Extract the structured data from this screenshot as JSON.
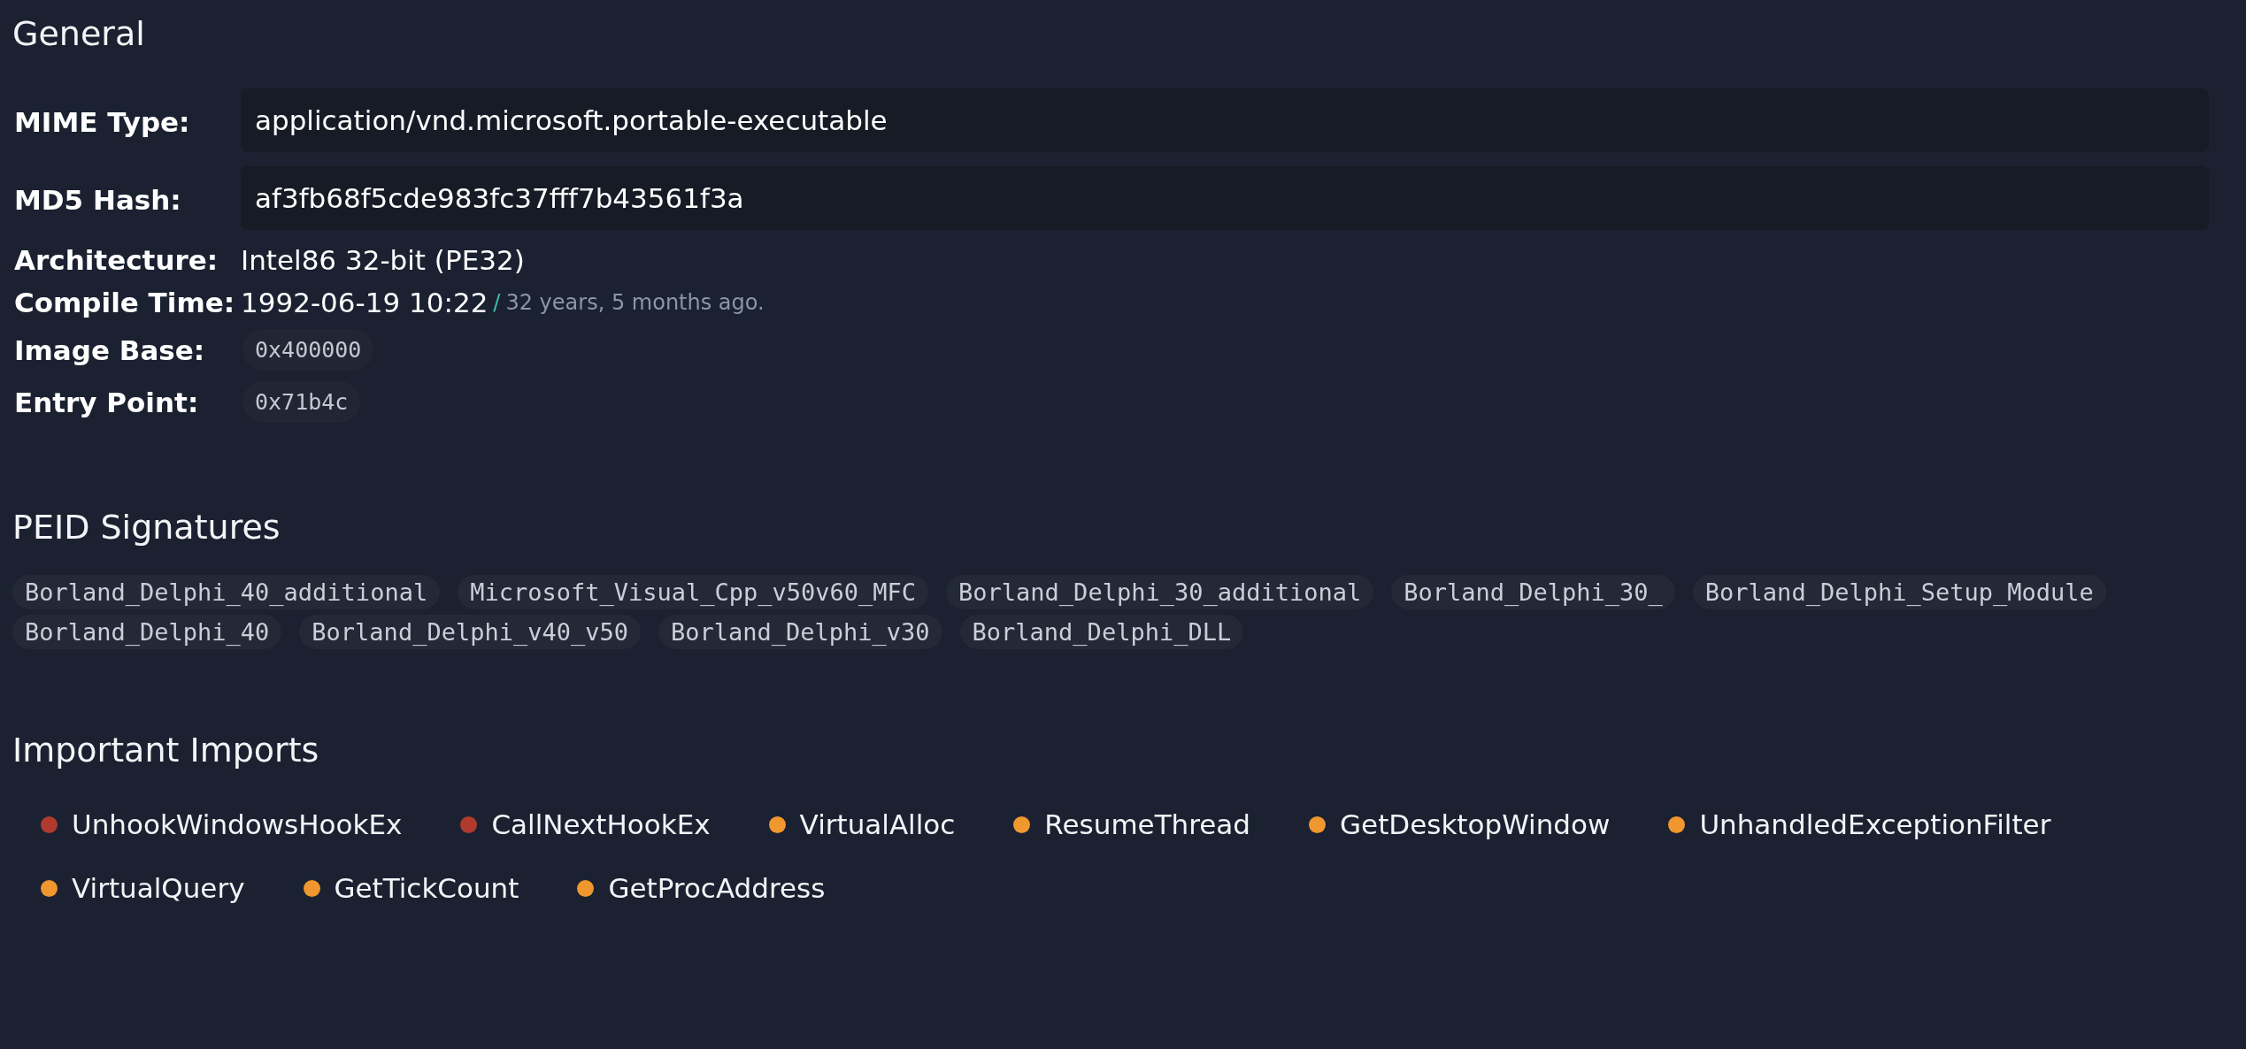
{
  "general": {
    "title": "General",
    "fields": [
      {
        "kind": "field",
        "label": "MIME Type:",
        "value": "application/vnd.microsoft.portable-executable"
      },
      {
        "kind": "field",
        "label": "MD5 Hash:",
        "value": "af3fb68f5cde983fc37fff7b43561f3a"
      },
      {
        "kind": "text",
        "label": "Architecture:",
        "value": "Intel86 32-bit (PE32)"
      },
      {
        "kind": "time",
        "label": "Compile Time:",
        "value": "1992-06-19 10:22",
        "separator": "/",
        "note": "32 years, 5 months ago."
      },
      {
        "kind": "code",
        "label": "Image Base:",
        "value": "0x400000"
      },
      {
        "kind": "code",
        "label": "Entry Point:",
        "value": "0x71b4c"
      }
    ]
  },
  "peid": {
    "title": "PEID Signatures",
    "signatures": [
      "Borland_Delphi_40_additional",
      "Microsoft_Visual_Cpp_v50v60_MFC",
      "Borland_Delphi_30_additional",
      "Borland_Delphi_30_",
      "Borland_Delphi_Setup_Module",
      "Borland_Delphi_40",
      "Borland_Delphi_v40_v50",
      "Borland_Delphi_v30",
      "Borland_Delphi_DLL"
    ]
  },
  "imports": {
    "title": "Important Imports",
    "items": [
      {
        "name": "UnhookWindowsHookEx",
        "color": "#b03a2e"
      },
      {
        "name": "CallNextHookEx",
        "color": "#b03a2e"
      },
      {
        "name": "VirtualAlloc",
        "color": "#f0972f"
      },
      {
        "name": "ResumeThread",
        "color": "#f0972f"
      },
      {
        "name": "GetDesktopWindow",
        "color": "#f0972f"
      },
      {
        "name": "UnhandledExceptionFilter",
        "color": "#f0972f"
      },
      {
        "name": "VirtualQuery",
        "color": "#f0972f"
      },
      {
        "name": "GetTickCount",
        "color": "#f0972f"
      },
      {
        "name": "GetProcAddress",
        "color": "#f0972f"
      }
    ]
  }
}
